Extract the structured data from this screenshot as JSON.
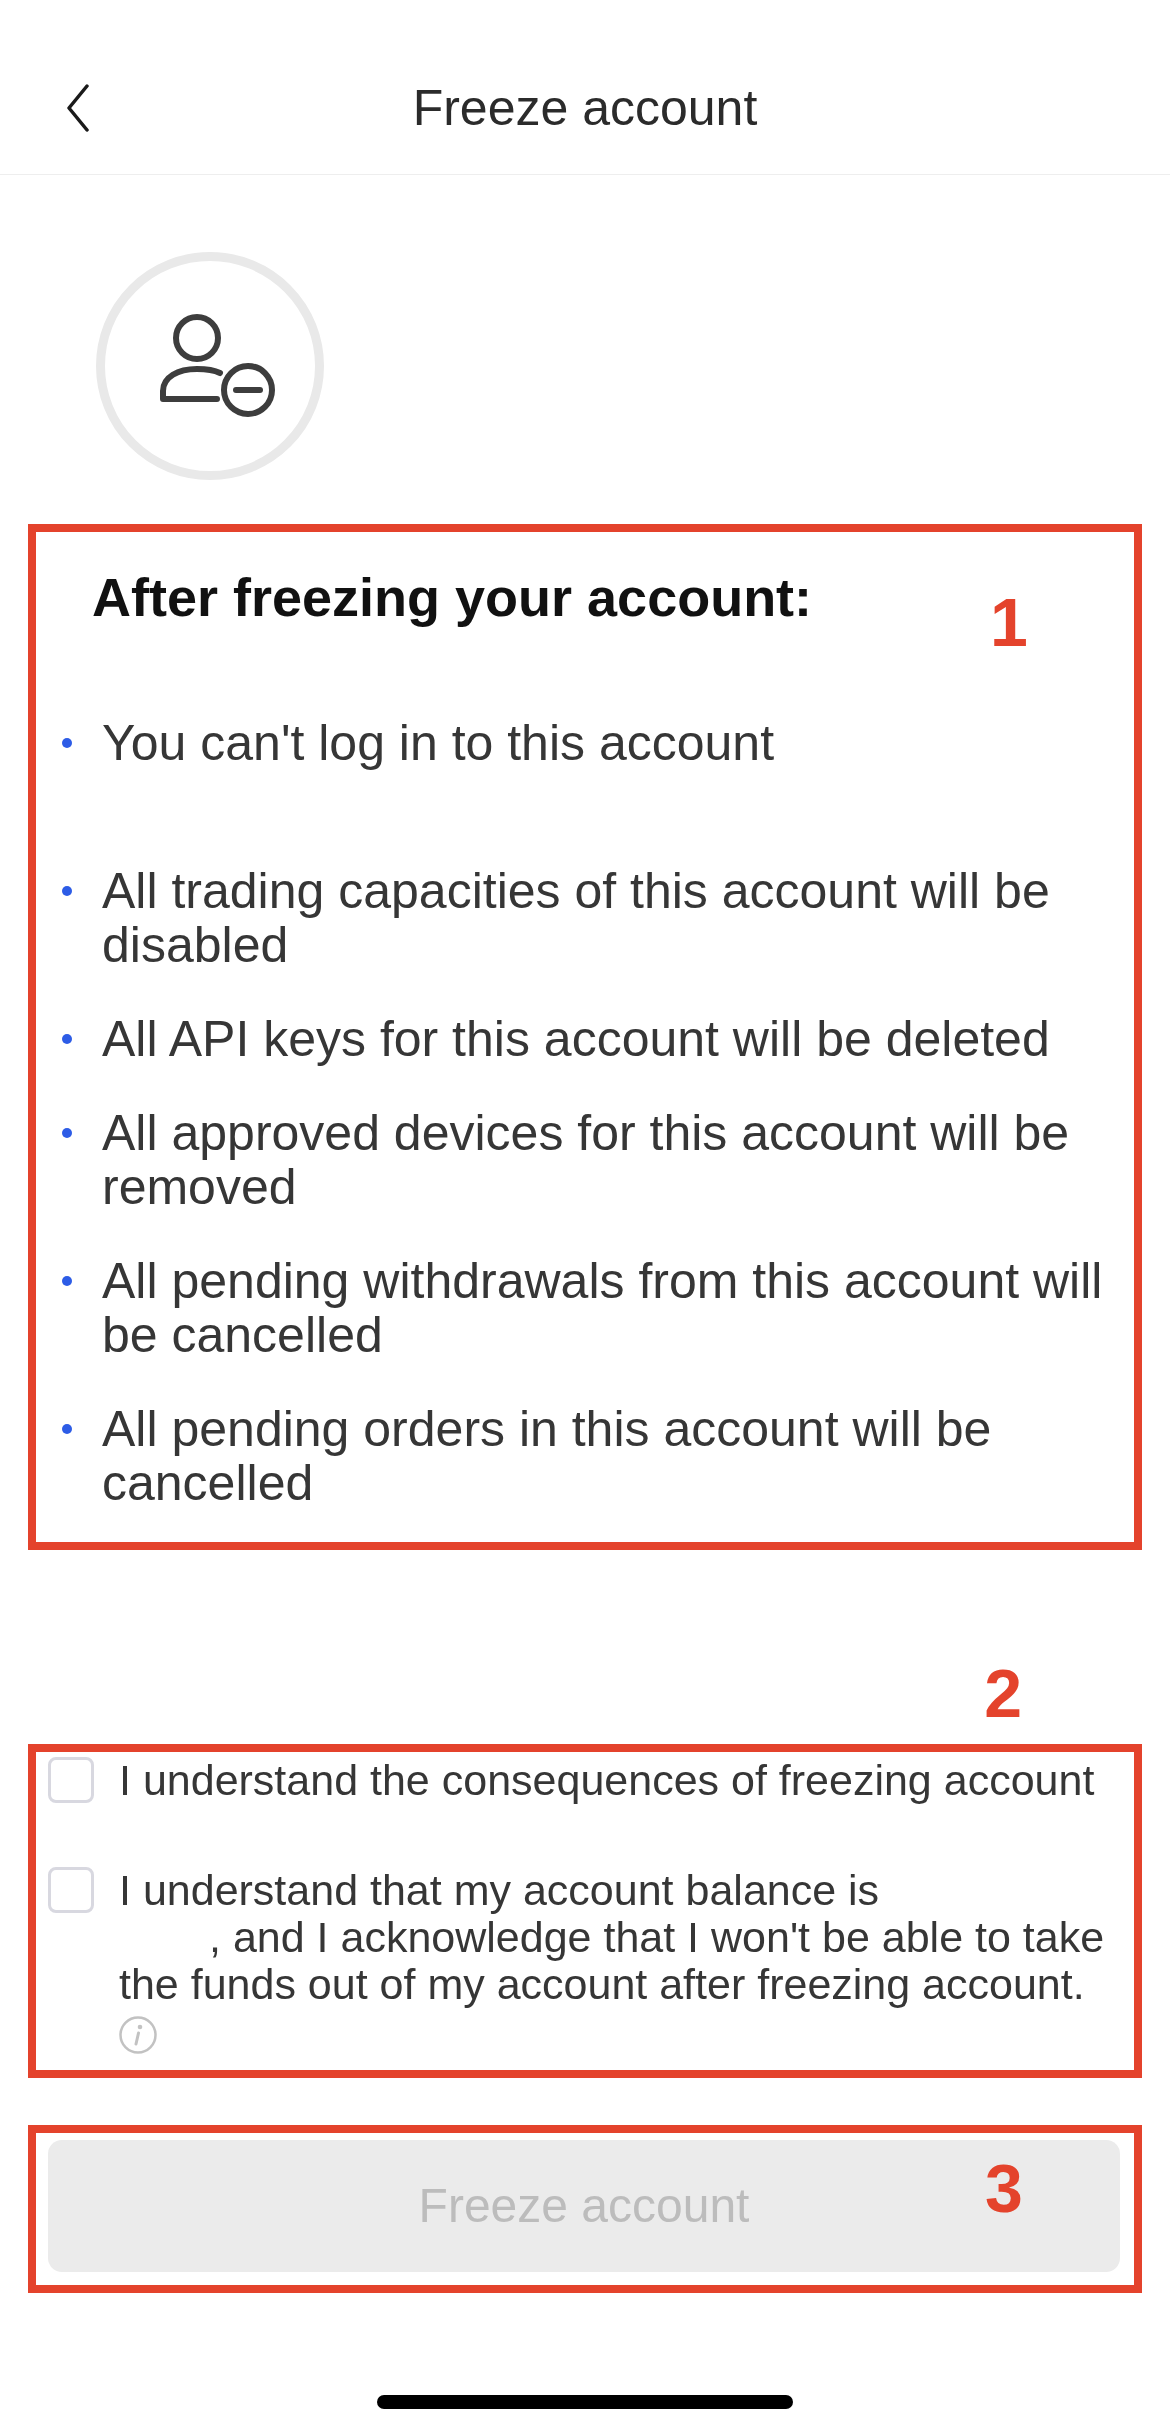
{
  "header": {
    "title": "Freeze account"
  },
  "notice": {
    "annotation": "1",
    "heading": "After freezing your account:",
    "items": [
      {
        "kind": "redacted",
        "text": "You can't log in to this account"
      },
      {
        "kind": "plain",
        "text": "All trading capacities of this account will be disabled"
      },
      {
        "kind": "plain",
        "text": "All API keys for this account will be deleted"
      },
      {
        "kind": "plain",
        "text": "All approved devices for this account will be removed"
      },
      {
        "kind": "plain",
        "text": "All pending withdrawals from this account will be cancelled"
      },
      {
        "kind": "plain",
        "text": "All pending orders in this account will be cancelled"
      }
    ]
  },
  "consents": {
    "annotation": "2",
    "items": [
      {
        "text": "I understand the consequences of freezing account",
        "checked": false,
        "info": false
      },
      {
        "text": "I understand that my account balance is",
        "text_after": ", and I acknowledge that I won't be able to take the funds out of my account after freezing account.",
        "checked": false,
        "info": true
      }
    ]
  },
  "action": {
    "annotation": "3",
    "button": {
      "label": "Freeze account",
      "disabled": true
    }
  }
}
